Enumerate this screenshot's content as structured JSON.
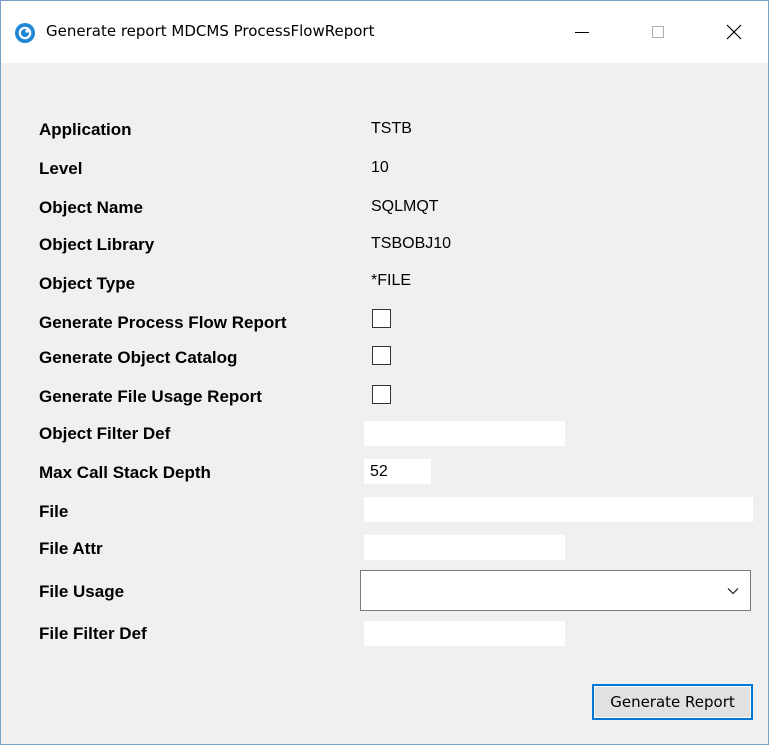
{
  "window": {
    "title": "Generate report MDCMS ProcessFlowReport",
    "icon": "app-logo-icon",
    "accent": "#0078d7",
    "icon_color": "#1e88d6"
  },
  "fields": {
    "application": {
      "label": "Application",
      "value": "TSTB"
    },
    "level": {
      "label": "Level",
      "value": "10"
    },
    "object_name": {
      "label": "Object Name",
      "value": "SQLMQT"
    },
    "object_library": {
      "label": "Object Library",
      "value": "TSBOBJ10"
    },
    "object_type": {
      "label": "Object Type",
      "value": "*FILE"
    }
  },
  "options": {
    "process_flow": {
      "label": "Generate Process Flow Report",
      "checked": false
    },
    "object_catalog": {
      "label": "Generate Object Catalog",
      "checked": false
    },
    "file_usage_report": {
      "label": "Generate File Usage Report",
      "checked": false
    }
  },
  "inputs": {
    "object_filter_def": {
      "label": "Object Filter Def",
      "value": ""
    },
    "max_call_stack_depth": {
      "label": "Max Call Stack Depth",
      "value": "52"
    },
    "file": {
      "label": "File",
      "value": ""
    },
    "file_attr": {
      "label": "File Attr",
      "value": ""
    },
    "file_usage": {
      "label": "File Usage",
      "selected": ""
    },
    "file_filter_def": {
      "label": "File Filter Def",
      "value": ""
    }
  },
  "actions": {
    "generate_report": "Generate Report"
  }
}
